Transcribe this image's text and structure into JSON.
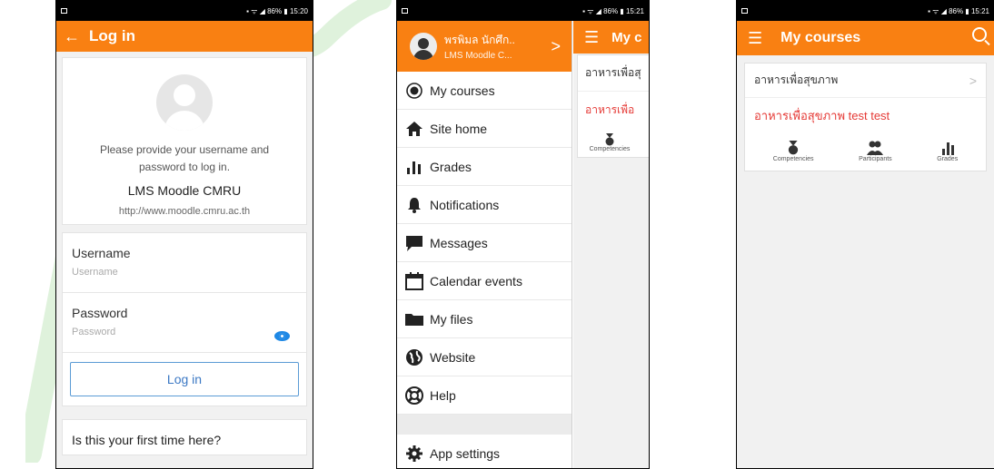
{
  "screen1": {
    "status_time": "15:20",
    "status_battery": "86%",
    "title": "Log in",
    "site_description": "Please provide your username and password to log in.",
    "site_name": "LMS Moodle CMRU",
    "site_url": "http://www.moodle.cmru.ac.th",
    "username_label": "Username",
    "username_placeholder": "Username",
    "password_label": "Password",
    "password_placeholder": "Password",
    "login_button": "Log in",
    "first_time_text": "Is this your first time here?"
  },
  "screen2": {
    "status_time": "15:21",
    "status_battery": "86%",
    "user_name": "พรพิมล นักศึก..",
    "user_site": "LMS Moodle C...",
    "menu_items": [
      {
        "label": "My courses",
        "icon": "radio-icon"
      },
      {
        "label": "Site home",
        "icon": "home-icon"
      },
      {
        "label": "Grades",
        "icon": "grades-icon"
      },
      {
        "label": "Notifications",
        "icon": "bell-icon"
      },
      {
        "label": "Messages",
        "icon": "chat-icon"
      },
      {
        "label": "Calendar events",
        "icon": "calendar-icon"
      },
      {
        "label": "My files",
        "icon": "folder-icon"
      },
      {
        "label": "Website",
        "icon": "globe-icon"
      },
      {
        "label": "Help",
        "icon": "lifebuoy-icon"
      }
    ],
    "settings_label": "App settings",
    "pane_title": "My c",
    "course1": "อาหารเพื่อสุ",
    "course2": "อาหารเพื่อ",
    "competencies": "Competencies"
  },
  "screen3": {
    "status_time": "15:21",
    "status_battery": "86%",
    "title": "My courses",
    "course1": "อาหารเพื่อสุขภาพ",
    "course2": "อาหารเพื่อสุขภาพ test test",
    "actions": [
      "Competencies",
      "Participants",
      "Grades"
    ]
  },
  "colors": {
    "brand_orange": "#f98012",
    "link_blue": "#3b78c4",
    "course_red": "#e53935"
  }
}
